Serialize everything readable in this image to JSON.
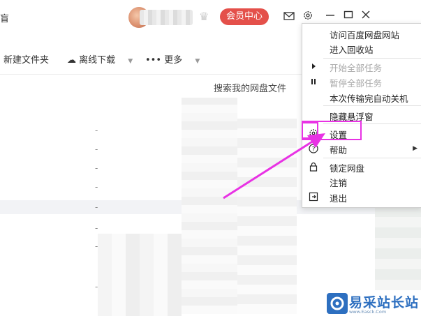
{
  "header": {
    "partial_title": "盲",
    "vip_button": "会员中心"
  },
  "toolbar": {
    "new_folder": "新建文件夹",
    "offline_download": "离线下载",
    "more": "更多"
  },
  "search": {
    "hint": "搜索我的网盘文件"
  },
  "menu": {
    "items": [
      {
        "label": "访问百度网盘网站",
        "disabled": false
      },
      {
        "label": "进入回收站",
        "disabled": false
      },
      {
        "label": "开始全部任务",
        "disabled": true
      },
      {
        "label": "暂停全部任务",
        "disabled": true
      },
      {
        "label": "本次传输完自动关机",
        "disabled": false
      },
      {
        "label": "隐藏悬浮窗",
        "disabled": false
      },
      {
        "label": "设置",
        "disabled": false
      },
      {
        "label": "帮助",
        "disabled": false
      },
      {
        "label": "锁定网盘",
        "disabled": false
      },
      {
        "label": "注销",
        "disabled": false
      },
      {
        "label": "退出",
        "disabled": false
      }
    ]
  },
  "watermark": {
    "text": "易采站长站",
    "url": "www.Easck.Com"
  },
  "colors": {
    "vip_red": "#e4504a",
    "highlight_magenta": "#e832e4",
    "watermark_blue": "#2d6fc0"
  }
}
